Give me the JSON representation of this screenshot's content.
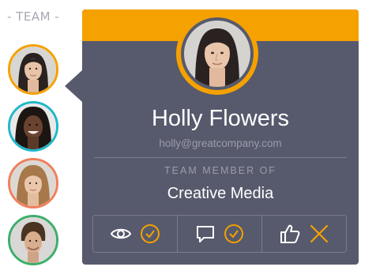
{
  "team_heading": "- TEAM -",
  "team_members": [
    {
      "photo": "woman-dark-hair-photo",
      "ring_color": "#f5a100",
      "selected": true
    },
    {
      "photo": "man-dreadlocks-photo",
      "ring_color": "#1fb8c9",
      "selected": false
    },
    {
      "photo": "woman-blonde-photo",
      "ring_color": "#f07f5c",
      "selected": false
    },
    {
      "photo": "man-curly-hair-photo",
      "ring_color": "#3dae6a",
      "selected": false
    }
  ],
  "profile": {
    "name": "Holly Flowers",
    "email": "holly@greatcompany.com",
    "member_of_label": "TEAM MEMBER OF",
    "group": "Creative Media"
  },
  "actions": [
    {
      "icon": "eye-icon",
      "status_icon": "check-circle-icon"
    },
    {
      "icon": "comment-icon",
      "status_icon": "check-circle-icon"
    },
    {
      "icon": "thumbs-up-icon",
      "status_icon": "close-x-icon"
    }
  ],
  "colors": {
    "accent": "#f5a100",
    "card_background": "#575a6c",
    "muted_text": "#9a9caa",
    "heading_text": "#a7a9b1"
  }
}
